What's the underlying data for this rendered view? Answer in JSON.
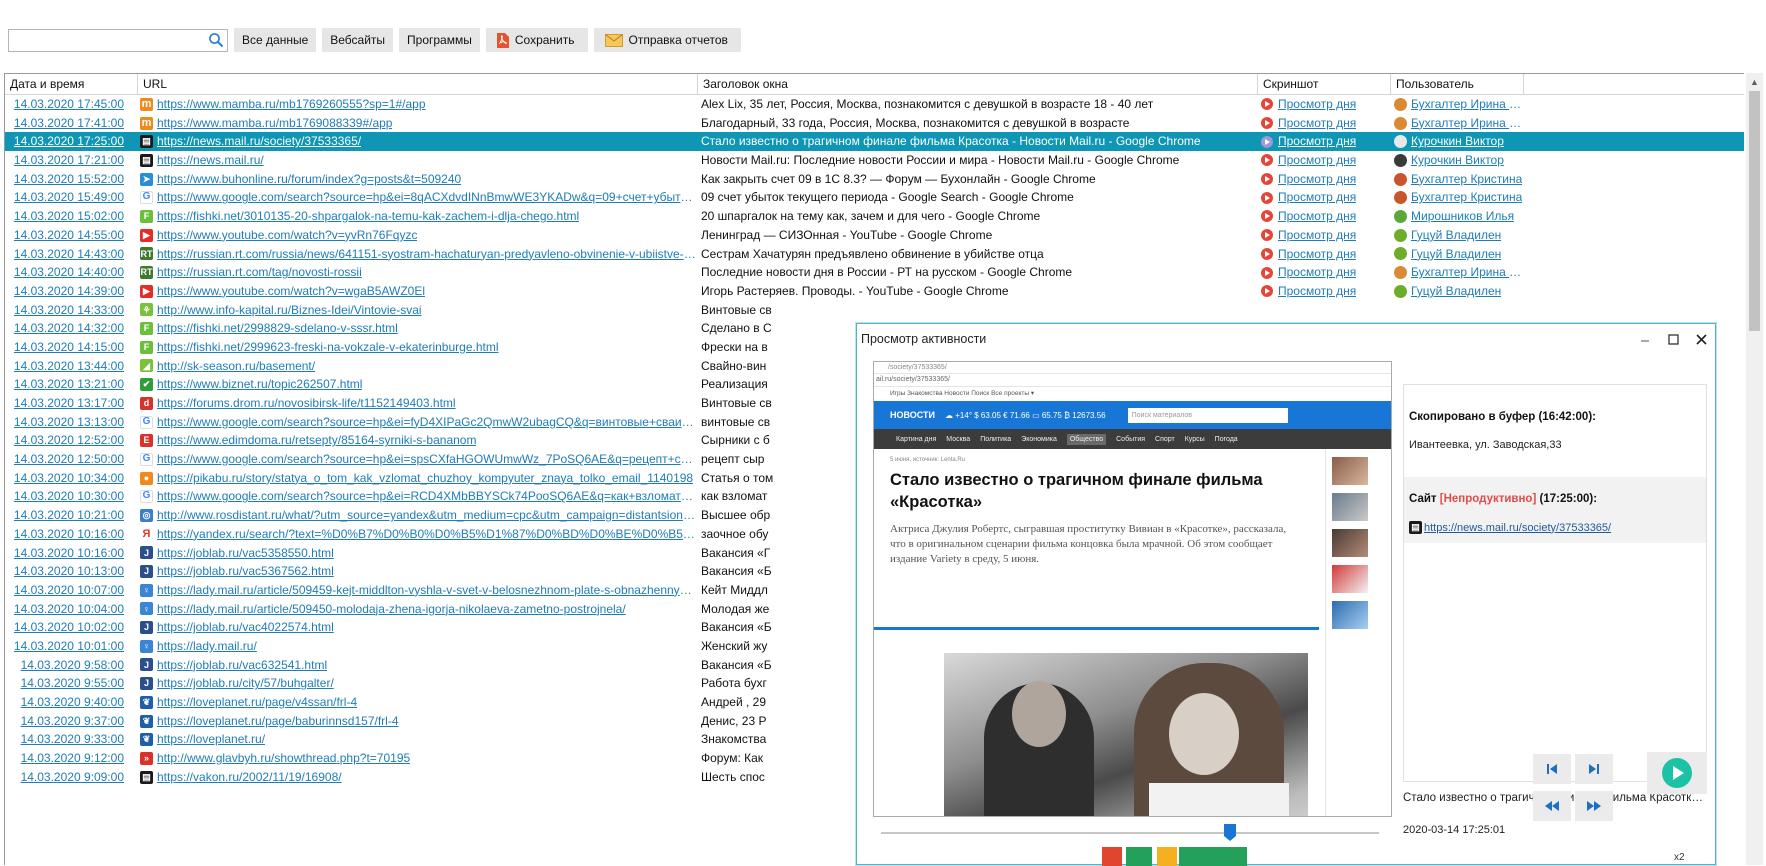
{
  "toolbar": {
    "search_placeholder": "",
    "buttons": [
      "Все данные",
      "Вебсайты",
      "Программы",
      "Сохранить",
      "Отправка отчетов"
    ]
  },
  "grid": {
    "headers": [
      "Дата и время",
      "URL",
      "Заголовок окна",
      "Скриншот",
      "Пользователь"
    ],
    "rows": [
      {
        "dt": "14.03.2020 17:45:00",
        "url": "https://www.mamba.ru/mb1769260555?sp=1#/app",
        "title": "Alex Lix, 35 лет, Россия, Москва, познакомится с девушкой в возрасте 18 - 40 лет",
        "shot": "Просмотр дня",
        "user": "Бухгалтер Ирина Пет...",
        "fav": "m",
        "favc": "#f08a1c",
        "avc": "#d98a32"
      },
      {
        "dt": "14.03.2020 17:41:00",
        "url": "https://www.mamba.ru/mb1769088339#/app",
        "title": "Благодарный, 33 года, Россия, Москва, познакомится с девушкой в возрасте",
        "shot": "Просмотр дня",
        "user": "Бухгалтер Ирина Пет...",
        "fav": "m",
        "favc": "#f08a1c",
        "avc": "#d98a32"
      },
      {
        "dt": "14.03.2020 17:25:00",
        "url": "https://news.mail.ru/society/37533365/",
        "title": "Стало известно о трагичном финале фильма Красотка - Новости Mail.ru - Google Chrome",
        "shot": "Просмотр дня",
        "user": "Курочкин Виктор",
        "fav": "▤",
        "favc": "#1a1a1a",
        "avc": "#e9e9e9",
        "selected": true
      },
      {
        "dt": "14.03.2020 17:21:00",
        "url": "https://news.mail.ru/",
        "title": " Новости Mail.ru: Последние новости России и мира - Новости Mail.ru - Google Chrome",
        "shot": "Просмотр дня",
        "user": "Курочкин Виктор",
        "fav": "▤",
        "favc": "#1a1a1a",
        "avc": "#3a3a3a"
      },
      {
        "dt": "14.03.2020 15:52:00",
        "url": "https://www.buhonline.ru/forum/index?g=posts&t=509240",
        "title": "Как закрыть счет 09 в 1С 8.3? — Форум — Бухонлайн - Google Chrome",
        "shot": "Просмотр дня",
        "user": "Бухгалтер Кристина",
        "fav": "➤",
        "favc": "#2a8fd6",
        "avc": "#c9562b"
      },
      {
        "dt": "14.03.2020 15:49:00",
        "url": "https://www.google.com/search?source=hp&ei=8qACXdvdINnBmwWE3YKADw&q=09+счет+убыток+текущег...",
        "title": "09 счет убыток текущего периода - Google Search - Google Chrome",
        "shot": "Просмотр дня",
        "user": "Бухгалтер Кристина",
        "fav": "G",
        "favc": "#ffffff",
        "avc": "#c9562b",
        "g": true
      },
      {
        "dt": "14.03.2020 15:02:00",
        "url": "https://fishki.net/3010135-20-shpargalok-na-temu-kak-zachem-i-dlja-chego.html",
        "title": "20 шпаргалок на тему как, зачем и для чего - Google Chrome",
        "shot": "Просмотр дня",
        "user": "Мирошников Илья",
        "fav": "F",
        "favc": "#6cbf3a",
        "avc": "#5aa83a"
      },
      {
        "dt": "14.03.2020 14:55:00",
        "url": "https://www.youtube.com/watch?v=yvRn76Fqyzc",
        "title": "Ленинград — СИЗОнная - YouTube - Google Chrome",
        "shot": "Просмотр дня",
        "user": "Гуцуй Владилен",
        "fav": "▶",
        "favc": "#e52d27",
        "avc": "#6cae2b"
      },
      {
        "dt": "14.03.2020 14:43:00",
        "url": "https://russian.rt.com/russia/news/641151-syostram-hachaturyan-predyavleno-obvinenie-v-ubiistve-otca",
        "title": "Сестрам Хачатурян предъявлено обвинение в убийстве отца",
        "shot": "Просмотр дня",
        "user": "Гуцуй Владилен",
        "fav": "RT",
        "favc": "#3f7a2e",
        "avc": "#6cae2b"
      },
      {
        "dt": "14.03.2020 14:40:00",
        "url": "https://russian.rt.com/tag/novosti-rossii",
        "title": "Последние новости дня в России - РТ на русском - Google Chrome",
        "shot": "Просмотр дня",
        "user": "Бухгалтер Ирина Пет...",
        "fav": "RT",
        "favc": "#3f7a2e",
        "avc": "#d98a32"
      },
      {
        "dt": "14.03.2020 14:39:00",
        "url": "https://www.youtube.com/watch?v=wgaB5AWZ0El",
        "title": "Игорь Растеряев. Проводы. - YouTube - Google Chrome",
        "shot": "Просмотр дня",
        "user": "Гуцуй Владилен",
        "fav": "▶",
        "favc": "#e52d27",
        "avc": "#6cae2b"
      },
      {
        "dt": "14.03.2020 14:33:00",
        "url": "http://www.info-kapital.ru/Biznes-Idei/Vintovie-svai",
        "title": "Винтовые св",
        "fav": "⚘",
        "favc": "#7cc13a"
      },
      {
        "dt": "14.03.2020 14:32:00",
        "url": "https://fishki.net/2998829-sdelano-v-sssr.html",
        "title": "Сделано в С",
        "fav": "F",
        "favc": "#6cbf3a"
      },
      {
        "dt": "14.03.2020 14:15:00",
        "url": "https://fishki.net/2999623-freski-na-vokzale-v-ekaterinburge.html",
        "title": "Фрески на в",
        "fav": "F",
        "favc": "#6cbf3a"
      },
      {
        "dt": "14.03.2020 13:44:00",
        "url": "http://sk-season.ru/basement/",
        "title": "Свайно-вин",
        "fav": "◢",
        "favc": "#7cc13a"
      },
      {
        "dt": "14.03.2020 13:21:00",
        "url": "https://www.biznet.ru/topic262507.html",
        "title": "Реализация",
        "fav": "✔",
        "favc": "#2e9e3a"
      },
      {
        "dt": "14.03.2020 13:17:00",
        "url": "https://forums.drom.ru/novosibirsk-life/t1152149403.html",
        "title": "Винтовые св",
        "fav": "d",
        "favc": "#d8322b"
      },
      {
        "dt": "14.03.2020 13:13:00",
        "url": "https://www.google.com/search?source=hp&ei=fyD4XIPaGc2QmwW2ubagCQ&q=винтовые+сваи+как+прод...",
        "title": "винтовые св",
        "fav": "G",
        "favc": "#ffffff",
        "g": true
      },
      {
        "dt": "14.03.2020 12:52:00",
        "url": "https://www.edimdoma.ru/retsepty/85164-syrniki-s-bananom",
        "title": "Сырники с б",
        "fav": "E",
        "favc": "#d8322b"
      },
      {
        "dt": "14.03.2020 12:50:00",
        "url": "https://www.google.com/search?source=hp&ei=spsCXfaHGOWUmwWz_7PoSQ6AE&q=рецепт+сырников+с+бан...",
        "title": "рецепт сыр",
        "fav": "G",
        "favc": "#ffffff",
        "g": true
      },
      {
        "dt": "14.03.2020 10:34:00",
        "url": "https://pikabu.ru/story/statya_o_tom_kak_vzlomat_chuzhoy_kompyuter_znaya_tolko_email_1140198",
        "title": "Статья о том",
        "fav": "●",
        "favc": "#f08a1c"
      },
      {
        "dt": "14.03.2020 10:30:00",
        "url": "https://www.google.com/search?source=hp&ei=RCD4XMbBBYSCk74PooSQ6AE&q=как+взломать+компьюте...",
        "title": "как взломат",
        "fav": "G",
        "favc": "#ffffff",
        "g": true
      },
      {
        "dt": "14.03.2020 10:21:00",
        "url": "http://www.rosdistant.ru/what/?utm_source=yandex&utm_medium=cpc&utm_campaign=distantsionno_ekon...",
        "title": "Высшее обр",
        "fav": "◎",
        "favc": "#3b7fc4"
      },
      {
        "dt": "14.03.2020 10:16:00",
        "url": "https://yandex.ru/search/?text=%D0%B7%D0%B0%D0%B5%D1%87%D0%BD%D0%BE%D0%B5%20%D0%BE%D0%B...",
        "title": "заочное обу",
        "fav": "Я",
        "favc": "#ffffff",
        "ya": true
      },
      {
        "dt": "14.03.2020 10:16:00",
        "url": "https://joblab.ru/vac5358550.html",
        "title": "Вакансия «Г",
        "fav": "J",
        "favc": "#2a4f8a"
      },
      {
        "dt": "14.03.2020 10:13:00",
        "url": "https://joblab.ru/vac5367562.html",
        "title": "Вакансия «Б",
        "fav": "J",
        "favc": "#2a4f8a"
      },
      {
        "dt": "14.03.2020 10:07:00",
        "url": "https://lady.mail.ru/article/509459-kejt-middlton-vyshla-v-svet-v-belosnezhnom-plate-s-obnazhennymi-plecha...",
        "title": "Кейт Миддл",
        "fav": "♀",
        "favc": "#3a86d4"
      },
      {
        "dt": "14.03.2020 10:04:00",
        "url": "https://lady.mail.ru/article/509450-molodaja-zhena-igorja-nikolaeva-zametno-postrojnela/",
        "title": "Молодая же",
        "fav": "♀",
        "favc": "#3a86d4"
      },
      {
        "dt": "14.03.2020 10:02:00",
        "url": "https://joblab.ru/vac4022574.html",
        "title": "Вакансия «Б",
        "fav": "J",
        "favc": "#2a4f8a"
      },
      {
        "dt": "14.03.2020 10:01:00",
        "url": "https://lady.mail.ru/",
        "title": "Женский жу",
        "fav": "♀",
        "favc": "#3a86d4"
      },
      {
        "dt": "14.03.2020 9:58:00",
        "url": "https://joblab.ru/vac632541.html",
        "title": "Вакансия «Б",
        "fav": "J",
        "favc": "#2a4f8a"
      },
      {
        "dt": "14.03.2020 9:55:00",
        "url": "https://joblab.ru/city/57/buhgalter/",
        "title": "Работа бухг",
        "fav": "J",
        "favc": "#2a4f8a"
      },
      {
        "dt": "14.03.2020 9:40:00",
        "url": "https://loveplanet.ru/page/v4ssan/frl-4",
        "title": "Андрей , 29",
        "fav": "❦",
        "favc": "#1f5ea8"
      },
      {
        "dt": "14.03.2020 9:37:00",
        "url": "https://loveplanet.ru/page/baburinnsd157/frl-4",
        "title": "Денис, 23 Р",
        "fav": "❦",
        "favc": "#1f5ea8"
      },
      {
        "dt": "14.03.2020 9:33:00",
        "url": "https://loveplanet.ru/",
        "title": "Знакомства",
        "fav": "❦",
        "favc": "#1f5ea8"
      },
      {
        "dt": "14.03.2020 9:12:00",
        "url": "http://www.glavbyh.ru/showthread.php?t=70195",
        "title": "Форум: Как",
        "fav": "»",
        "favc": "#d8322b"
      },
      {
        "dt": "14.03.2020 9:09:00",
        "url": "https://vakon.ru/2002/11/19/16908/",
        "title": "Шесть спос",
        "fav": "▤",
        "favc": "#1a1a1a"
      }
    ]
  },
  "modal": {
    "title": "Просмотр активности",
    "screenshot": {
      "url_short": "/society/37533365/",
      "url_domain": "ail.ru/society/37533365/",
      "toplinks": "Игры  Знакомства  Новости  Поиск  Все проекты ▾",
      "brand": "НОВОСТИ",
      "ticker": "☁ +14°   $ 63.05   € 71.66   ▭ 65.75   ₿ 12673.56",
      "search_placeholder": "Поиск материалов",
      "nav": [
        "Картина дня",
        "Москва",
        "Политика",
        "Экономика",
        "Общество",
        "События",
        "Спорт",
        "Курсы",
        "Погода"
      ],
      "source_line": "5 июня, источник: Lenta.Ru",
      "headline": "Стало известно о трагичном финале фильма «Красотка»",
      "lead": "Актриса Джулия Робертс, сыгравшая проститутку Вивиан в «Красотке», рассказала, что в оригинальном сценарии фильма концовка была мрачной. Об этом сообщает издание Variety в среду, 5 июня."
    },
    "clipboard": {
      "heading": "Скопировано в буфер (16:42:00):",
      "value": "Ивантеевка, ул. Заводская,33"
    },
    "site": {
      "label": "Сайт",
      "status": "[Непродуктивно]",
      "time": "(17:25:00):",
      "url": "https://news.mail.ru/society/37533365/"
    },
    "caption": "Стало известно о трагичном финале фильма Красотка...",
    "timestamp": "2020-03-14 17:25:01",
    "speed": "x2"
  }
}
